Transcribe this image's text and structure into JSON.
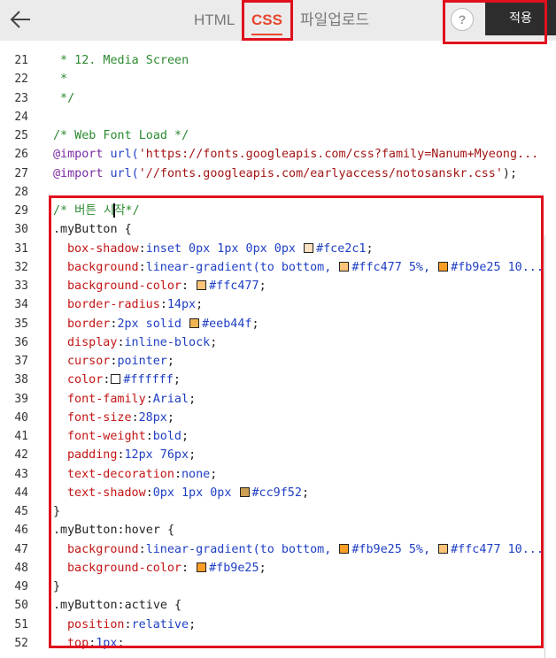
{
  "toolbar": {
    "tabs": [
      "HTML",
      "CSS",
      "파일업로드"
    ],
    "active_tab": "CSS",
    "help_label": "?",
    "apply_label": "적용",
    "accent_color": "#e8462f",
    "apply_bg": "#2d2d2d"
  },
  "highlight_color": "#e0101e",
  "editor": {
    "lines": [
      {
        "n": "21",
        "segs": [
          {
            "c": "com",
            "t": " * 12. Media Screen"
          }
        ]
      },
      {
        "n": "22",
        "segs": [
          {
            "c": "com",
            "t": " *"
          }
        ]
      },
      {
        "n": "23",
        "segs": [
          {
            "c": "com",
            "t": " */"
          }
        ]
      },
      {
        "n": "24",
        "segs": []
      },
      {
        "n": "25",
        "segs": [
          {
            "c": "com",
            "t": "/* Web Font Load */"
          }
        ]
      },
      {
        "n": "26",
        "segs": [
          {
            "c": "kw",
            "t": "@import "
          },
          {
            "c": "val",
            "t": "url("
          },
          {
            "c": "str",
            "t": "'https://fonts.googleapis.com/css?family=Nanum+Myeong..."
          }
        ]
      },
      {
        "n": "27",
        "segs": [
          {
            "c": "kw",
            "t": "@import "
          },
          {
            "c": "val",
            "t": "url("
          },
          {
            "c": "str",
            "t": "'//fonts.googleapis.com/earlyaccess/notosanskr.css'"
          },
          {
            "c": "punc",
            "t": ");"
          }
        ]
      },
      {
        "n": "28",
        "segs": []
      },
      {
        "n": "29",
        "segs": [
          {
            "c": "com",
            "t": "/* 버튼 시"
          },
          {
            "c": "cursor",
            "t": ""
          },
          {
            "c": "com",
            "t": "작*/"
          }
        ]
      },
      {
        "n": "30",
        "segs": [
          {
            "c": "sel",
            "t": ".myButton {"
          }
        ]
      },
      {
        "n": "31",
        "ind": 1,
        "segs": [
          {
            "c": "prop",
            "t": "box-shadow"
          },
          {
            "c": "punc",
            "t": ":"
          },
          {
            "c": "val",
            "t": "inset 0px 1px 0px 0px "
          },
          {
            "c": "sw",
            "t": "#fce2c1"
          },
          {
            "c": "val",
            "t": "#fce2c1"
          },
          {
            "c": "punc",
            "t": ";"
          }
        ]
      },
      {
        "n": "32",
        "ind": 1,
        "segs": [
          {
            "c": "prop",
            "t": "background"
          },
          {
            "c": "punc",
            "t": ":"
          },
          {
            "c": "val",
            "t": "linear-gradient(to bottom, "
          },
          {
            "c": "sw",
            "t": "#ffc477"
          },
          {
            "c": "val",
            "t": "#ffc477 5%, "
          },
          {
            "c": "sw",
            "t": "#fb9e25"
          },
          {
            "c": "val",
            "t": "#fb9e25 10..."
          }
        ]
      },
      {
        "n": "33",
        "ind": 1,
        "segs": [
          {
            "c": "prop",
            "t": "background-color"
          },
          {
            "c": "punc",
            "t": ": "
          },
          {
            "c": "sw",
            "t": "#ffc477"
          },
          {
            "c": "val",
            "t": "#ffc477"
          },
          {
            "c": "punc",
            "t": ";"
          }
        ]
      },
      {
        "n": "34",
        "ind": 1,
        "segs": [
          {
            "c": "prop",
            "t": "border-radius"
          },
          {
            "c": "punc",
            "t": ":"
          },
          {
            "c": "val",
            "t": "14px"
          },
          {
            "c": "punc",
            "t": ";"
          }
        ]
      },
      {
        "n": "35",
        "ind": 1,
        "segs": [
          {
            "c": "prop",
            "t": "border"
          },
          {
            "c": "punc",
            "t": ":"
          },
          {
            "c": "val",
            "t": "2px solid "
          },
          {
            "c": "sw",
            "t": "#eeb44f"
          },
          {
            "c": "val",
            "t": "#eeb44f"
          },
          {
            "c": "punc",
            "t": ";"
          }
        ]
      },
      {
        "n": "36",
        "ind": 1,
        "segs": [
          {
            "c": "prop",
            "t": "display"
          },
          {
            "c": "punc",
            "t": ":"
          },
          {
            "c": "val",
            "t": "inline-block"
          },
          {
            "c": "punc",
            "t": ";"
          }
        ]
      },
      {
        "n": "37",
        "ind": 1,
        "segs": [
          {
            "c": "prop",
            "t": "cursor"
          },
          {
            "c": "punc",
            "t": ":"
          },
          {
            "c": "val",
            "t": "pointer"
          },
          {
            "c": "punc",
            "t": ";"
          }
        ]
      },
      {
        "n": "38",
        "ind": 1,
        "segs": [
          {
            "c": "prop",
            "t": "color"
          },
          {
            "c": "punc",
            "t": ":"
          },
          {
            "c": "sw",
            "t": "#ffffff"
          },
          {
            "c": "val",
            "t": "#ffffff"
          },
          {
            "c": "punc",
            "t": ";"
          }
        ]
      },
      {
        "n": "39",
        "ind": 1,
        "segs": [
          {
            "c": "prop",
            "t": "font-family"
          },
          {
            "c": "punc",
            "t": ":"
          },
          {
            "c": "val",
            "t": "Arial"
          },
          {
            "c": "punc",
            "t": ";"
          }
        ]
      },
      {
        "n": "40",
        "ind": 1,
        "segs": [
          {
            "c": "prop",
            "t": "font-size"
          },
          {
            "c": "punc",
            "t": ":"
          },
          {
            "c": "val",
            "t": "28px"
          },
          {
            "c": "punc",
            "t": ";"
          }
        ]
      },
      {
        "n": "41",
        "ind": 1,
        "segs": [
          {
            "c": "prop",
            "t": "font-weight"
          },
          {
            "c": "punc",
            "t": ":"
          },
          {
            "c": "val",
            "t": "bold"
          },
          {
            "c": "punc",
            "t": ";"
          }
        ]
      },
      {
        "n": "42",
        "ind": 1,
        "segs": [
          {
            "c": "prop",
            "t": "padding"
          },
          {
            "c": "punc",
            "t": ":"
          },
          {
            "c": "val",
            "t": "12px 76px"
          },
          {
            "c": "punc",
            "t": ";"
          }
        ]
      },
      {
        "n": "43",
        "ind": 1,
        "segs": [
          {
            "c": "prop",
            "t": "text-decoration"
          },
          {
            "c": "punc",
            "t": ":"
          },
          {
            "c": "val",
            "t": "none"
          },
          {
            "c": "punc",
            "t": ";"
          }
        ]
      },
      {
        "n": "44",
        "ind": 1,
        "segs": [
          {
            "c": "prop",
            "t": "text-shadow"
          },
          {
            "c": "punc",
            "t": ":"
          },
          {
            "c": "val",
            "t": "0px 1px 0px "
          },
          {
            "c": "sw",
            "t": "#cc9f52"
          },
          {
            "c": "val",
            "t": "#cc9f52"
          },
          {
            "c": "punc",
            "t": ";"
          }
        ]
      },
      {
        "n": "45",
        "segs": [
          {
            "c": "sel",
            "t": "}"
          }
        ]
      },
      {
        "n": "46",
        "segs": [
          {
            "c": "sel",
            "t": ".myButton:hover {"
          }
        ]
      },
      {
        "n": "47",
        "ind": 1,
        "segs": [
          {
            "c": "prop",
            "t": "background"
          },
          {
            "c": "punc",
            "t": ":"
          },
          {
            "c": "val",
            "t": "linear-gradient(to bottom, "
          },
          {
            "c": "sw",
            "t": "#fb9e25"
          },
          {
            "c": "val",
            "t": "#fb9e25 5%, "
          },
          {
            "c": "sw",
            "t": "#ffc477"
          },
          {
            "c": "val",
            "t": "#ffc477 10..."
          }
        ]
      },
      {
        "n": "48",
        "ind": 1,
        "segs": [
          {
            "c": "prop",
            "t": "background-color"
          },
          {
            "c": "punc",
            "t": ": "
          },
          {
            "c": "sw",
            "t": "#fb9e25"
          },
          {
            "c": "val",
            "t": "#fb9e25"
          },
          {
            "c": "punc",
            "t": ";"
          }
        ]
      },
      {
        "n": "49",
        "segs": [
          {
            "c": "sel",
            "t": "}"
          }
        ]
      },
      {
        "n": "50",
        "segs": [
          {
            "c": "sel",
            "t": ".myButton:active {"
          }
        ]
      },
      {
        "n": "51",
        "ind": 1,
        "segs": [
          {
            "c": "prop",
            "t": "position"
          },
          {
            "c": "punc",
            "t": ":"
          },
          {
            "c": "val",
            "t": "relative"
          },
          {
            "c": "punc",
            "t": ";"
          }
        ]
      },
      {
        "n": "52",
        "ind": 1,
        "segs": [
          {
            "c": "prop",
            "t": "top"
          },
          {
            "c": "punc",
            "t": ":"
          },
          {
            "c": "val",
            "t": "1px"
          },
          {
            "c": "punc",
            "t": ";"
          }
        ]
      }
    ]
  }
}
